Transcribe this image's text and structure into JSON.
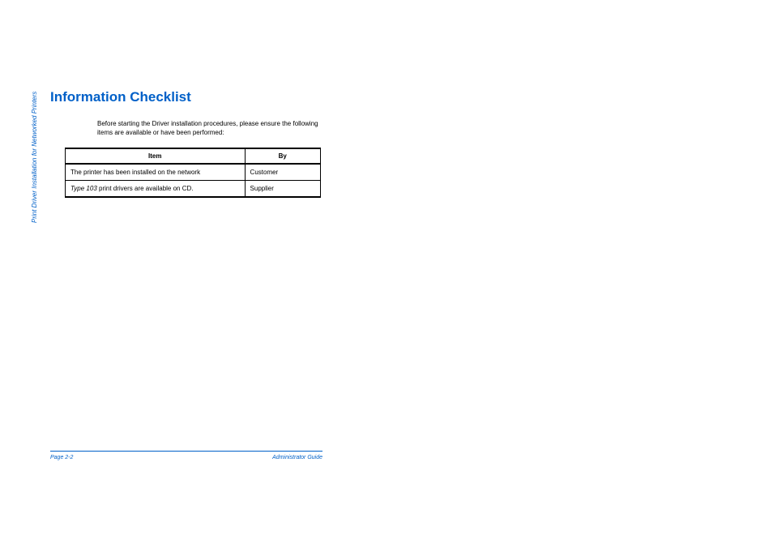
{
  "sideLabel": "Print Driver Installation for Networked Printers",
  "title": "Information Checklist",
  "intro": "Before starting the Driver installation procedures, please ensure the following items are available or have been performed:",
  "table": {
    "headers": {
      "item": "Item",
      "by": "By"
    },
    "rows": [
      {
        "itemPrefix": "",
        "item": "The printer has been installed on the network",
        "by": "Customer"
      },
      {
        "itemPrefix": "Type 103",
        "item": " print drivers are available on CD.",
        "by": "Supplier"
      }
    ]
  },
  "footer": {
    "pageLabel": "Page 2-2",
    "docLabel": "Administrator Guide"
  }
}
